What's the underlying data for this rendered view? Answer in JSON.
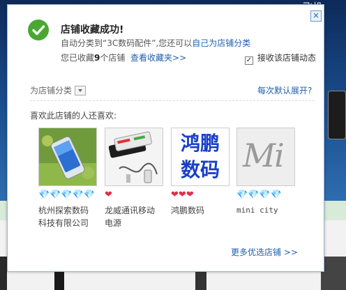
{
  "background": {
    "corner_text": "飞机"
  },
  "dialog": {
    "close_glyph": "×",
    "title": "店铺收藏成功!",
    "line1": {
      "prefix": "自动分类到",
      "category": "“3C数码配件”",
      "middle": ",您还可以",
      "link": "自己为店铺分类"
    },
    "line2": {
      "prefix": "您已收藏",
      "count": "9",
      "suffix": "个店铺",
      "link": "查看收藏夹>>"
    },
    "subscribe": {
      "checked": true,
      "label": "接收该店铺动态"
    },
    "category_label": "为店铺分类",
    "expand_link": "每次默认展开?",
    "also_like": "喜欢此店铺的人还喜欢:",
    "shops": [
      {
        "name_line1": "杭州探索数码",
        "name_line2": "科技有限公司",
        "rating_icon": "diamond-icon",
        "rating_count": 5
      },
      {
        "name_line1": "龙威通讯移动",
        "name_line2": "电源",
        "rating_icon": "heart-icon",
        "rating_count": 1
      },
      {
        "name_line1": "鸿鹏数码",
        "name_line2": "",
        "rating_icon": "heart-icon",
        "rating_count": 3,
        "logo_text_1": "鸿鹏",
        "logo_text_2": "数码"
      },
      {
        "name_line1": "mini city",
        "name_line2": "",
        "rating_icon": "diamond-icon",
        "rating_count": 4,
        "logo_text": "Mi"
      }
    ],
    "more_link": "更多优选店铺 >>"
  },
  "colors": {
    "link": "#1f5fae",
    "success": "#4aa832",
    "diamond": "#2aa9d6",
    "heart": "#e0304a"
  }
}
